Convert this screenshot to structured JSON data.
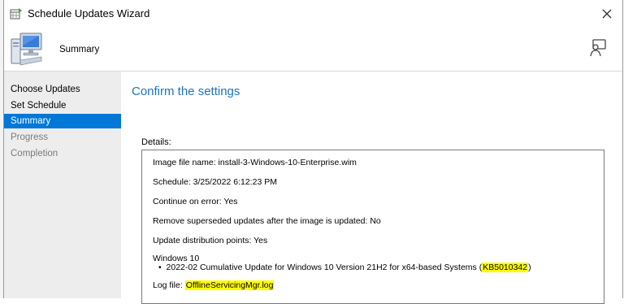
{
  "window": {
    "title": "Schedule Updates Wizard"
  },
  "header": {
    "title": "Summary"
  },
  "nav": {
    "items": [
      {
        "label": "Choose Updates",
        "state": "done"
      },
      {
        "label": "Set Schedule",
        "state": "done"
      },
      {
        "label": "Summary",
        "state": "active"
      },
      {
        "label": "Progress",
        "state": "disabled"
      },
      {
        "label": "Completion",
        "state": "disabled"
      }
    ]
  },
  "main": {
    "heading": "Confirm the settings",
    "details_label": "Details:",
    "details": {
      "image_file": "Image file name: install-3-Windows-10-Enterprise.wim",
      "schedule": "Schedule: 3/25/2022 6:12:23 PM",
      "continue_on_error": "Continue on error: Yes",
      "remove_superseded": "Remove superseded updates after the image is updated: No",
      "update_dps": "Update distribution points: Yes",
      "os": "Windows 10",
      "update_prefix": "2022-02 Cumulative Update for Windows 10 Version 21H2 for x64-based Systems (",
      "update_kb": "KB5010342",
      "update_suffix": ")",
      "log_prefix": "Log file: ",
      "log_file": "OfflineServicingMgr.log"
    }
  },
  "colors": {
    "accent": "#0078d7",
    "heading": "#1e73be",
    "highlight": "#fffb00"
  }
}
